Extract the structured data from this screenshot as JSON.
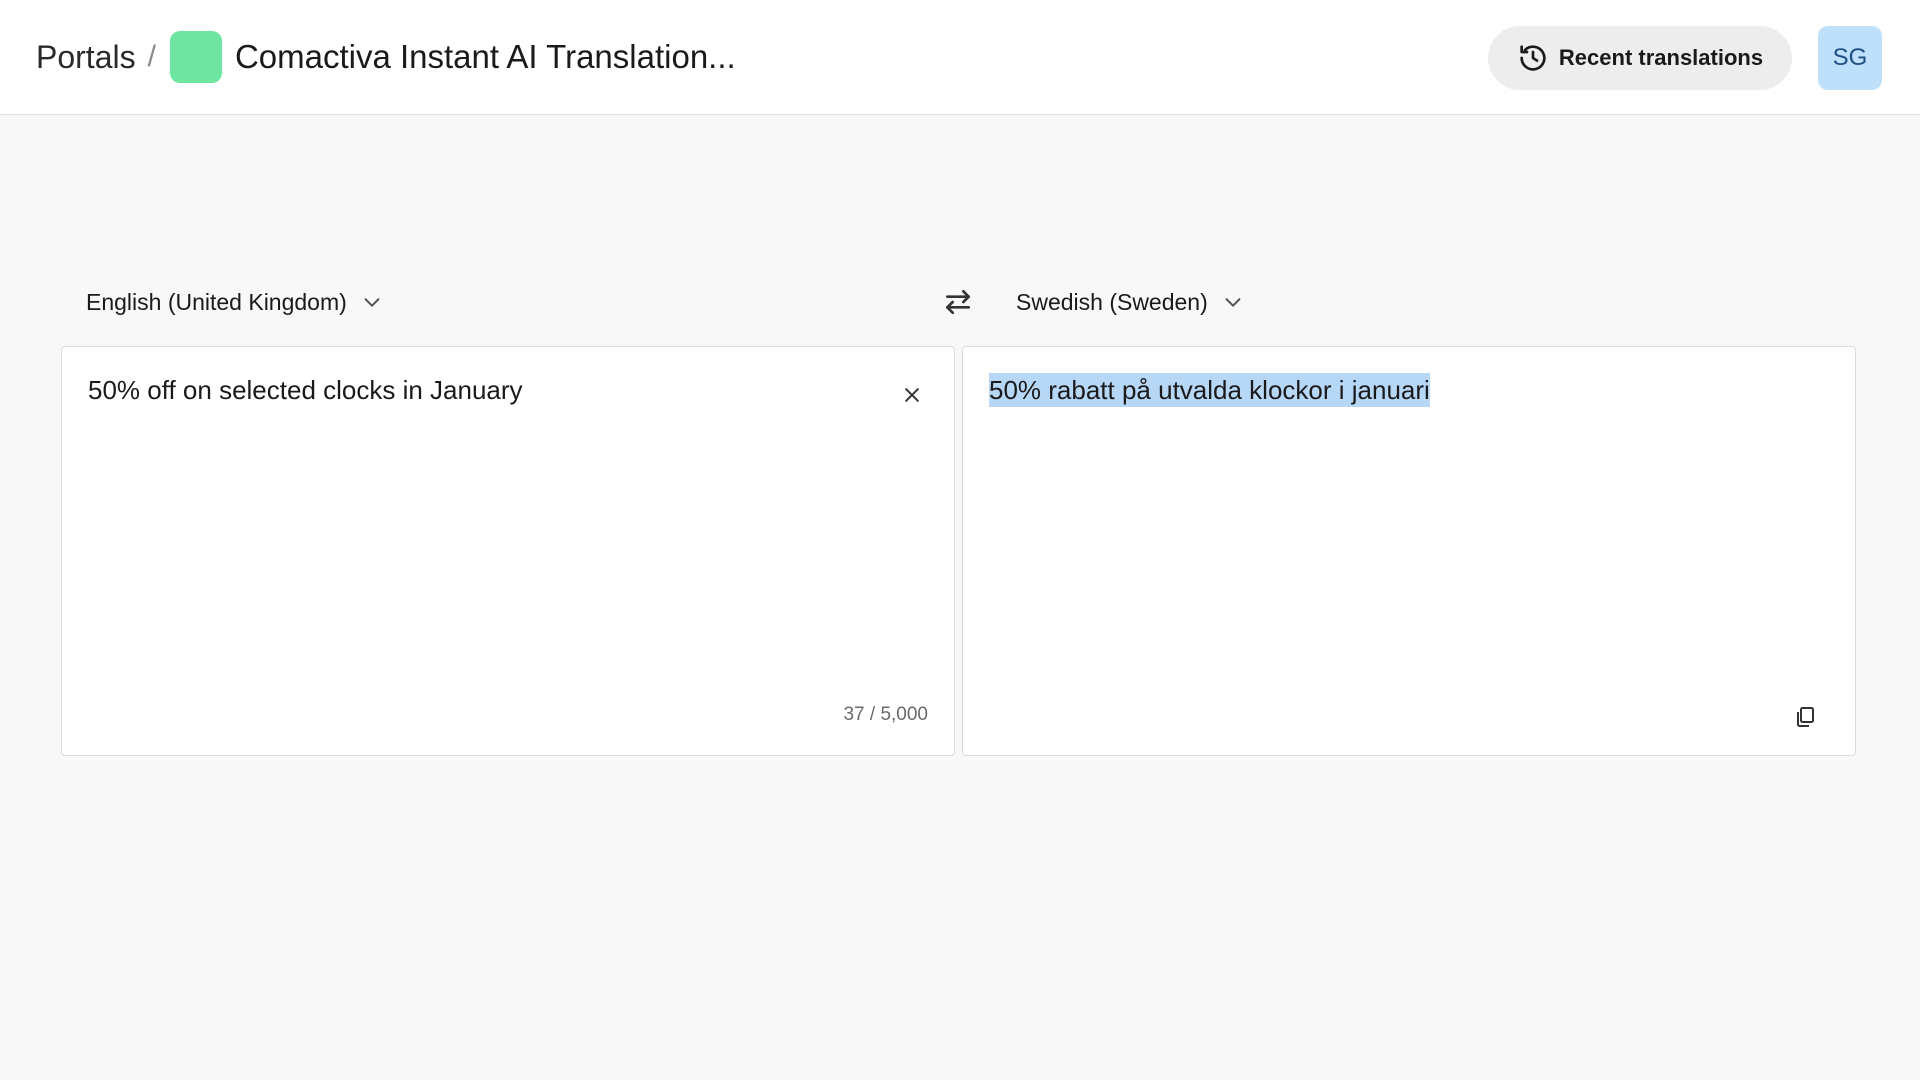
{
  "breadcrumb": {
    "root": "Portals",
    "separator": "/",
    "current": "Comactiva Instant AI Translation...",
    "portal_color": "#6ee6a1"
  },
  "header": {
    "recent_label": "Recent translations",
    "recent_icon": "history-icon",
    "avatar_initials": "SG"
  },
  "languages": {
    "source": "English (United Kingdom)",
    "target": "Swedish (Sweden)",
    "swap_icon": "swap-arrows-icon"
  },
  "source_panel": {
    "text": "50% off on selected clocks in January",
    "char_count": "37 / 5,000",
    "clear_icon": "close-icon"
  },
  "target_panel": {
    "text": "50% rabatt på utvalda klockor i januari",
    "copy_icon": "copy-icon",
    "selection_color": "#b7d7f7"
  }
}
